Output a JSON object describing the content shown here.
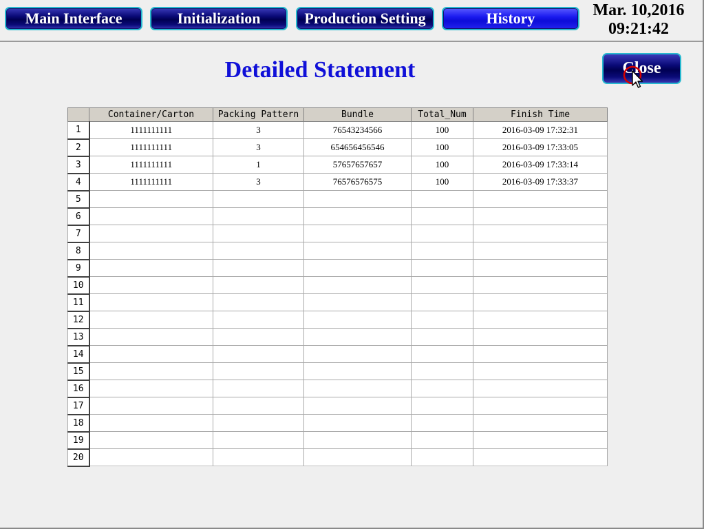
{
  "nav": {
    "main_interface": "Main Interface",
    "initialization": "Initialization",
    "production_setting": "Production Setting",
    "history": "History"
  },
  "clock": {
    "date": "Mar. 10,2016",
    "time": "09:21:42"
  },
  "page": {
    "title": "Detailed Statement",
    "close_label": "Close"
  },
  "table": {
    "columns": [
      "Container/Carton",
      "Packing Pattern",
      "Bundle",
      "Total_Num",
      "Finish Time"
    ],
    "rows": [
      {
        "num": "1",
        "cells": [
          "1111111111",
          "3",
          "76543234566",
          "100",
          "2016-03-09 17:32:31"
        ]
      },
      {
        "num": "2",
        "cells": [
          "1111111111",
          "3",
          "654656456546",
          "100",
          "2016-03-09 17:33:05"
        ]
      },
      {
        "num": "3",
        "cells": [
          "1111111111",
          "1",
          "57657657657",
          "100",
          "2016-03-09 17:33:14"
        ]
      },
      {
        "num": "4",
        "cells": [
          "1111111111",
          "3",
          "76576576575",
          "100",
          "2016-03-09 17:33:37"
        ]
      },
      {
        "num": "5",
        "cells": [
          "",
          "",
          "",
          "",
          ""
        ]
      },
      {
        "num": "6",
        "cells": [
          "",
          "",
          "",
          "",
          ""
        ]
      },
      {
        "num": "7",
        "cells": [
          "",
          "",
          "",
          "",
          ""
        ]
      },
      {
        "num": "8",
        "cells": [
          "",
          "",
          "",
          "",
          ""
        ]
      },
      {
        "num": "9",
        "cells": [
          "",
          "",
          "",
          "",
          ""
        ]
      },
      {
        "num": "10",
        "cells": [
          "",
          "",
          "",
          "",
          ""
        ]
      },
      {
        "num": "11",
        "cells": [
          "",
          "",
          "",
          "",
          ""
        ]
      },
      {
        "num": "12",
        "cells": [
          "",
          "",
          "",
          "",
          ""
        ]
      },
      {
        "num": "13",
        "cells": [
          "",
          "",
          "",
          "",
          ""
        ]
      },
      {
        "num": "14",
        "cells": [
          "",
          "",
          "",
          "",
          ""
        ]
      },
      {
        "num": "15",
        "cells": [
          "",
          "",
          "",
          "",
          ""
        ]
      },
      {
        "num": "16",
        "cells": [
          "",
          "",
          "",
          "",
          ""
        ]
      },
      {
        "num": "17",
        "cells": [
          "",
          "",
          "",
          "",
          ""
        ]
      },
      {
        "num": "18",
        "cells": [
          "",
          "",
          "",
          "",
          ""
        ]
      },
      {
        "num": "19",
        "cells": [
          "",
          "",
          "",
          "",
          ""
        ]
      },
      {
        "num": "20",
        "cells": [
          "",
          "",
          "",
          "",
          ""
        ]
      }
    ]
  },
  "icons": {
    "cursor": "mouse-pointer-icon"
  },
  "colors": {
    "title": "#1010d8",
    "button_border": "#27b8cf",
    "button_fill": "#000052",
    "active_button_fill": "#0c0cd8",
    "background": "#efefef"
  }
}
